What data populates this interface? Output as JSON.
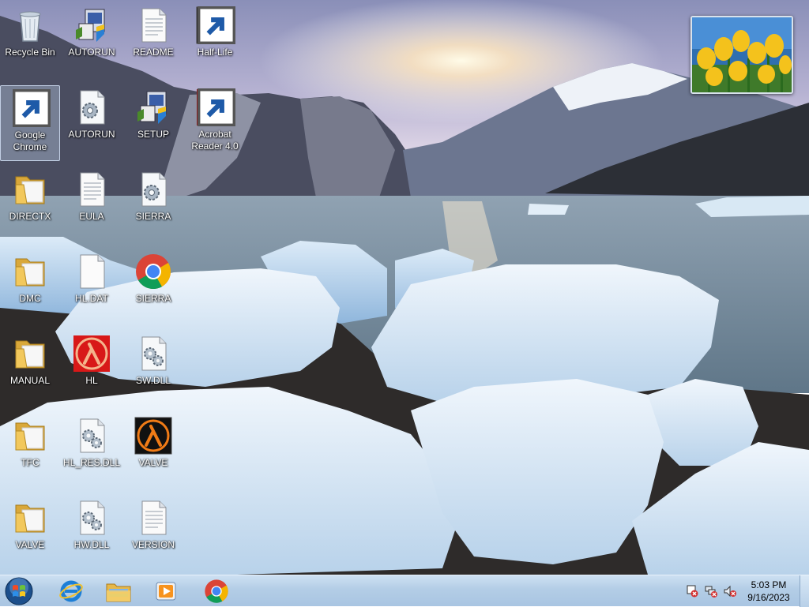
{
  "desktop": {
    "icons": [
      {
        "label": "Recycle Bin",
        "icon": "recycle-bin-icon",
        "shortcut": false
      },
      {
        "label": "AUTORUN",
        "icon": "setup-installer-icon",
        "shortcut": false
      },
      {
        "label": "README",
        "icon": "text-file-icon",
        "shortcut": false
      },
      {
        "label": "Half-Life",
        "icon": "half-life-icon",
        "shortcut": true
      },
      {
        "label": "Google Chrome",
        "icon": "chrome-icon",
        "shortcut": true
      },
      {
        "label": "AUTORUN",
        "icon": "config-file-icon",
        "shortcut": false
      },
      {
        "label": "SETUP",
        "icon": "setup-installer-icon",
        "shortcut": false
      },
      {
        "label": "Acrobat Reader 4.0",
        "icon": "acrobat-reader-icon",
        "shortcut": true
      },
      {
        "label": "DIRECTX",
        "icon": "folder-icon",
        "shortcut": false
      },
      {
        "label": "EULA",
        "icon": "text-file-icon",
        "shortcut": false
      },
      {
        "label": "SIERRA",
        "icon": "config-file-icon",
        "shortcut": false
      },
      {
        "label": "DMC",
        "icon": "folder-icon",
        "shortcut": false
      },
      {
        "label": "HL.DAT",
        "icon": "blank-file-icon",
        "shortcut": false
      },
      {
        "label": "SIERRA",
        "icon": "chrome-icon",
        "shortcut": false
      },
      {
        "label": "MANUAL",
        "icon": "folder-icon",
        "shortcut": false
      },
      {
        "label": "HL",
        "icon": "half-life-red-icon",
        "shortcut": false
      },
      {
        "label": "SW.DLL",
        "icon": "dll-file-icon",
        "shortcut": false
      },
      {
        "label": "TFC",
        "icon": "folder-icon",
        "shortcut": false
      },
      {
        "label": "HL_RES.DLL",
        "icon": "dll-file-icon",
        "shortcut": false
      },
      {
        "label": "VALVE",
        "icon": "half-life-icon",
        "shortcut": false
      },
      {
        "label": "VALVE",
        "icon": "folder-icon",
        "shortcut": false
      },
      {
        "label": "HW.DLL",
        "icon": "dll-file-icon",
        "shortcut": false
      },
      {
        "label": "VERSION",
        "icon": "text-file-icon",
        "shortcut": false
      }
    ],
    "selected_icon": "Google Chrome",
    "gadget": {
      "icon": "tulips-photo-icon"
    }
  },
  "taskbar": {
    "pinned": [
      {
        "icon": "start-orb-icon"
      },
      {
        "icon": "internet-explorer-icon"
      },
      {
        "icon": "file-explorer-icon"
      },
      {
        "icon": "media-player-icon"
      },
      {
        "icon": "chrome-icon"
      }
    ],
    "tray": [
      {
        "icon": "action-center-warning-icon"
      },
      {
        "icon": "network-disconnected-icon"
      },
      {
        "icon": "volume-muted-icon"
      }
    ],
    "clock": {
      "time": "5:03 PM",
      "date": "9/16/2023"
    }
  },
  "colors": {
    "taskbar": "#b3cde6",
    "accent": "#1e5aa8"
  }
}
